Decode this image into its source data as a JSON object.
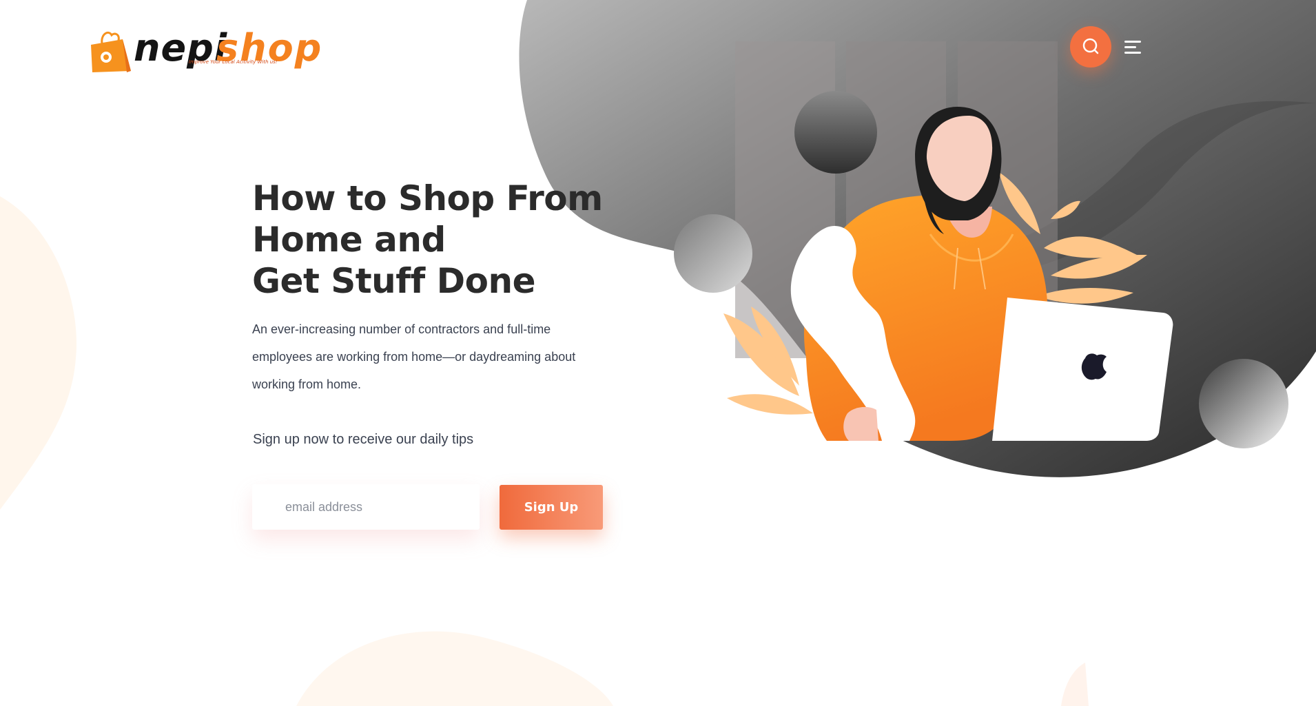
{
  "brand": {
    "name_part1": "nepi",
    "name_part2": "shop",
    "tagline": "Improve Your Local Acitivity With us!"
  },
  "header": {
    "search_icon": "search-icon",
    "menu_icon": "hamburger-menu-icon"
  },
  "hero": {
    "title_lines": [
      "How to Shop From",
      "Home and",
      "Get Stuff Done"
    ],
    "description": "An ever-increasing number of contractors and full-time employees are working from home—or daydreaming about working from home.",
    "signup_note": "Sign up now to receive our daily tips"
  },
  "signup_form": {
    "email_placeholder": "email address",
    "email_value": "",
    "button_label": "Sign Up"
  },
  "colors": {
    "accent": "#f37040",
    "brand_orange": "#f4811f",
    "title_text": "#2b2b2b",
    "body_text": "#3a4150",
    "blob_dark": "#3a3a3a",
    "blob_light": "#b3b3b3"
  }
}
